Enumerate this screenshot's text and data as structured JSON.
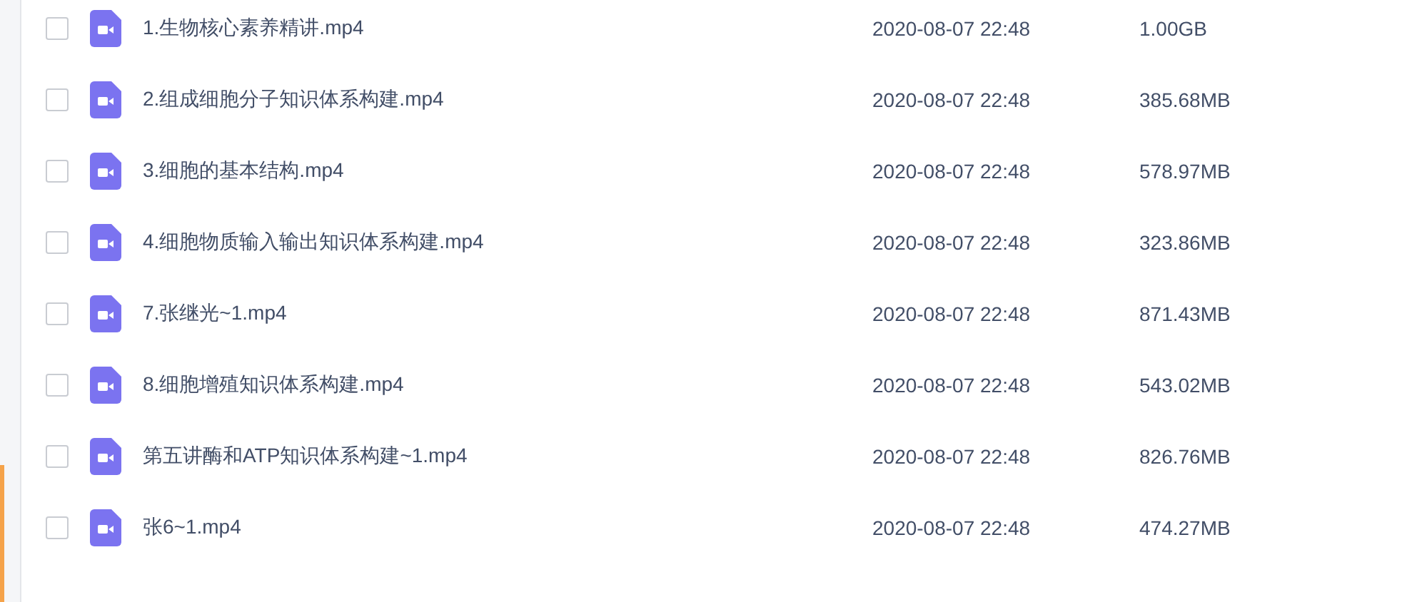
{
  "files": [
    {
      "name": "1.生物核心素养精讲.mp4",
      "modified": "2020-08-07 22:48",
      "size": "1.00GB",
      "checked": false
    },
    {
      "name": "2.组成细胞分子知识体系构建.mp4",
      "modified": "2020-08-07 22:48",
      "size": "385.68MB",
      "checked": false
    },
    {
      "name": "3.细胞的基本结构.mp4",
      "modified": "2020-08-07 22:48",
      "size": "578.97MB",
      "checked": false
    },
    {
      "name": "4.细胞物质输入输出知识体系构建.mp4",
      "modified": "2020-08-07 22:48",
      "size": "323.86MB",
      "checked": false
    },
    {
      "name": "7.张继光~1.mp4",
      "modified": "2020-08-07 22:48",
      "size": "871.43MB",
      "checked": false
    },
    {
      "name": "8.细胞增殖知识体系构建.mp4",
      "modified": "2020-08-07 22:48",
      "size": "543.02MB",
      "checked": false
    },
    {
      "name": "第五讲酶和ATP知识体系构建~1.mp4",
      "modified": "2020-08-07 22:48",
      "size": "826.76MB",
      "checked": false
    },
    {
      "name": "张6~1.mp4",
      "modified": "2020-08-07 22:48",
      "size": "474.27MB",
      "checked": false
    }
  ]
}
